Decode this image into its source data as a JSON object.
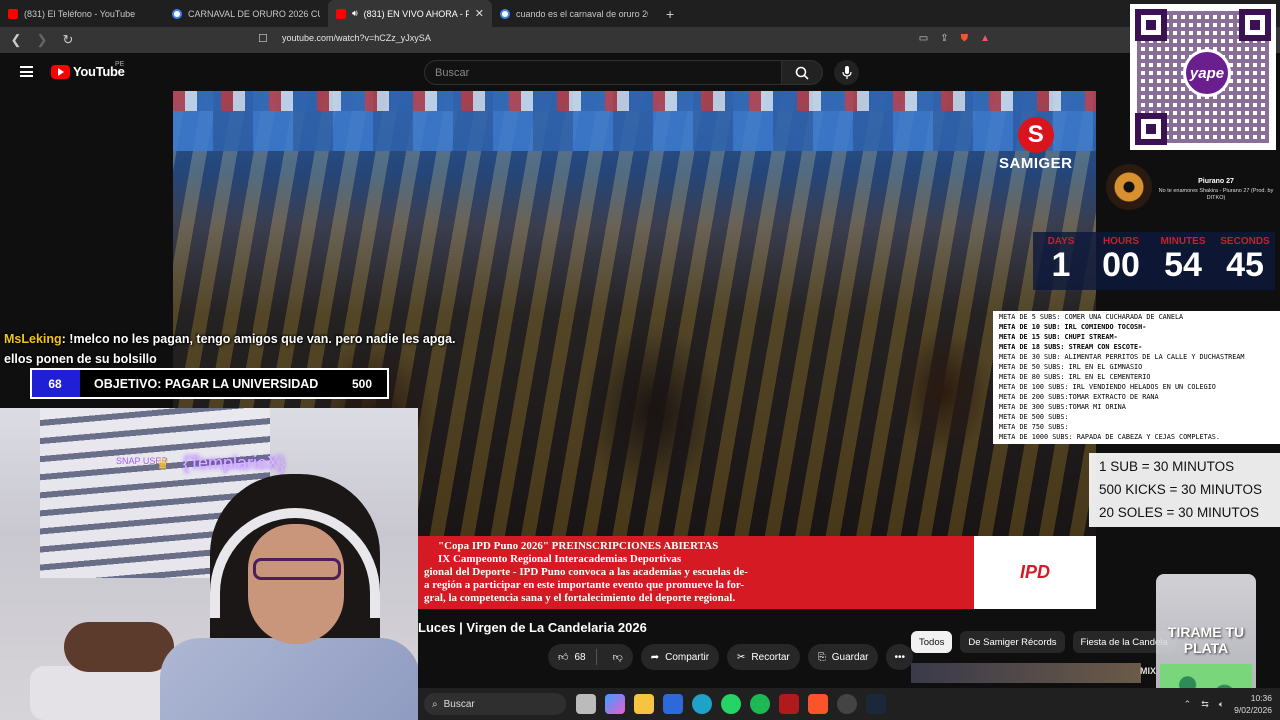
{
  "browser": {
    "tabs": [
      {
        "title": "(831) El Teléfono - YouTube",
        "icon": "youtube-icon",
        "active": false
      },
      {
        "title": "CARNAVAL DE ORURO 2026 CUANDO",
        "icon": "google-icon",
        "active": false
      },
      {
        "title": "(831) EN VIVO AHORA - F",
        "icon": "youtube-icon",
        "active": true
      },
      {
        "title": "cuando es el carnaval de oruro 2026",
        "icon": "google-icon",
        "active": false
      }
    ],
    "new_tab": "+",
    "url": "youtube.com/watch?v=hCZz_yJxySA"
  },
  "youtube": {
    "logo_text": "YouTube",
    "country": "PE",
    "search_placeholder": "Buscar",
    "video_title": "Luces | Virgen de La Candelaria 2026",
    "like_count": "68",
    "share_label": "Compartir",
    "clip_label": "Recortar",
    "save_label": "Guardar",
    "chips": [
      "Todos",
      "De Samiger Récords",
      "Fiesta de la Candela"
    ],
    "mix_label": "MIX",
    "video_brand": "SAMIGER",
    "banner_lines": [
      "\"Copa IPD Puno 2026\" PREINSCRIPCIONES ABIERTAS",
      "IX Campeonto Regional Interacademias Deportivas",
      "gional del Deporte - IPD Puno convoca a las academias y escuelas de-",
      "a región a participar en este importante evento que promueve la for-",
      "gral, la competencia sana y el fortalecimiento del deporte regional."
    ],
    "sponsor_logo": "IPD"
  },
  "stream": {
    "chat": {
      "user": "MsLeking",
      "message": ": !melco no les pagan, tengo amigos que van. pero nadie les apga. ellos ponen de su bolsillo"
    },
    "goal": {
      "current": "68",
      "label": "OBJETIVO: PAGAR LA UNIVERSIDAD",
      "max": "500",
      "progress": 0.136,
      "fill_color": "#1f20d6"
    },
    "sub_alert": {
      "tag": "SNAP USER",
      "name": "{TemplarioX}"
    },
    "qr_brand": "yape",
    "music": {
      "title": "Piurano 27",
      "artist": "No te enamores Shakira - Piurano 27 (Prod. by DITKO)"
    },
    "timer": {
      "labels": [
        "DAYS",
        "HOURS",
        "MINUTES",
        "SECONDS"
      ],
      "values": [
        "1",
        "00",
        "54",
        "45"
      ]
    },
    "metas": [
      {
        "text": "META DE 5 SUBS: COMER UNA CUCHARADA DE CANELA",
        "bold": false
      },
      {
        "text": "META DE 10 SUB: IRL COMIENDO TOCOSH-",
        "bold": true
      },
      {
        "text": "META DE 15 SUB: CHUPI STREAM-",
        "bold": true
      },
      {
        "text": "META DE 18 SUBS: STREAM CON ESCOTE-",
        "bold": true
      },
      {
        "text": "META DE 30 SUB:  ALIMENTAR PERRITOS DE LA CALLE Y DUCHASTREAM",
        "bold": false
      },
      {
        "text": "META DE 50 SUBS: IRL EN EL GIMNASIO",
        "bold": false
      },
      {
        "text": "META DE 80 SUBS: IRL EN EL CEMENTERIO",
        "bold": false
      },
      {
        "text": "META DE 100 SUBS: IRL VENDIENDO HELADOS EN UN COLEGIO",
        "bold": false
      },
      {
        "text": "META DE 200 SUBS:TOMAR EXTRACTO DE RANA",
        "bold": false
      },
      {
        "text": "META DE 300 SUBS:TOMAR MI ORINA",
        "bold": false
      },
      {
        "text": "META DE 500 SUBS:",
        "bold": false
      },
      {
        "text": "META DE 750 SUBS:",
        "bold": false
      },
      {
        "text": "META DE 1000 SUBS: RAPADA DE CABEZA Y CEJAS COMPLETAS.",
        "bold": false
      }
    ],
    "rates": [
      "1 SUB = 30 MINUTOS",
      "500 KICKS = 30 MINUTOS",
      "20 SOLES = 30 MINUTOS"
    ],
    "tipjar_text": "TIRAME TU PLATA"
  },
  "taskbar": {
    "search_label": "Buscar",
    "time": "10:36",
    "date": "9/02/2026"
  }
}
